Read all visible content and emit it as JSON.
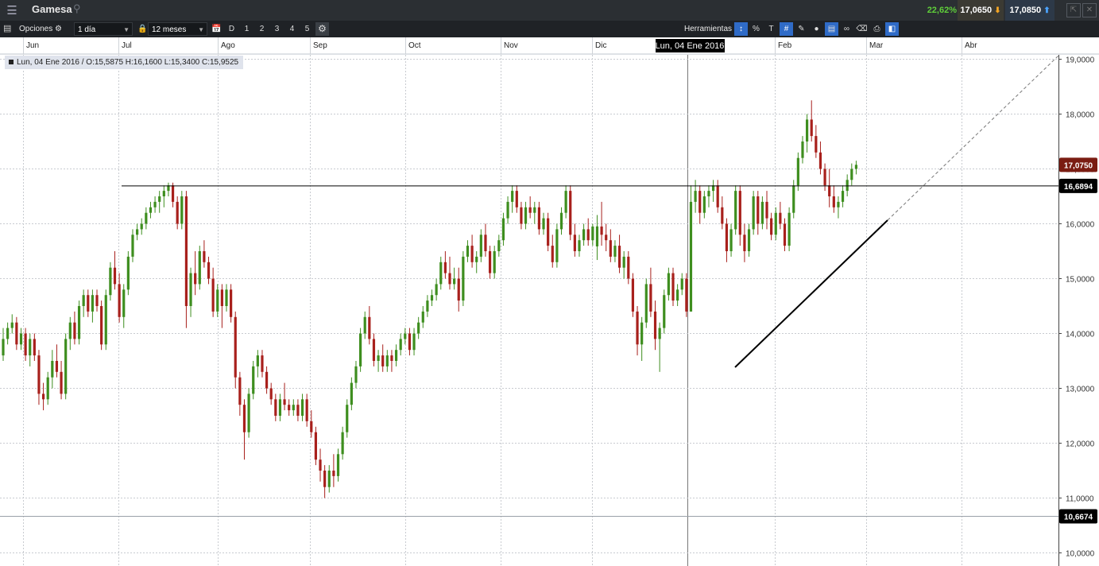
{
  "topbar": {
    "symbol": "Gamesa",
    "change_pct": "22,62%",
    "bid": "17,0650",
    "ask": "17,0850"
  },
  "toolbar": {
    "options_label": "Opciones",
    "interval": "1 día",
    "range": "12 meses",
    "periods": [
      "D",
      "1",
      "2",
      "3",
      "4",
      "5"
    ],
    "tools_label": "Herramientas"
  },
  "crosshair": {
    "date_label": "Lun, 04 Ene 2016",
    "info": "Lun, 04 Ene 2016 / O:15,5875  H:16,1600  L:15,3400  C:15,9525"
  },
  "colors": {
    "up": "#3e8e1f",
    "down": "#a8201c",
    "price_tag": "#7a1c12",
    "line_tag": "#000000"
  },
  "chart_data": {
    "type": "candlestick",
    "x_ticks": [
      "Jun",
      "Jul",
      "Ago",
      "Sep",
      "Oct",
      "Nov",
      "Dic",
      "Feb",
      "Mar",
      "Abr"
    ],
    "y_ticks": [
      "19,0000",
      "18,0000",
      "17,0000",
      "16,0000",
      "15,0000",
      "14,0000",
      "13,0000",
      "12,0000",
      "11,0000",
      "10,0000"
    ],
    "y_range": [
      10.0,
      19.0
    ],
    "last_price": "17,0750",
    "resistance_level": "16,6894",
    "lower_level": "10,6674",
    "candles": [
      [
        13.6,
        14.1,
        13.5,
        13.9
      ],
      [
        13.9,
        14.2,
        13.8,
        14.1
      ],
      [
        14.1,
        14.35,
        14.0,
        14.2
      ],
      [
        14.2,
        14.3,
        13.7,
        13.8
      ],
      [
        13.8,
        14.1,
        13.7,
        14.0
      ],
      [
        14.0,
        14.1,
        13.5,
        13.6
      ],
      [
        13.6,
        14.0,
        13.4,
        13.9
      ],
      [
        13.9,
        14.0,
        13.5,
        13.6
      ],
      [
        13.6,
        13.7,
        12.7,
        12.9
      ],
      [
        12.9,
        13.1,
        12.6,
        12.8
      ],
      [
        12.8,
        13.3,
        12.7,
        13.2
      ],
      [
        13.2,
        13.7,
        13.0,
        13.5
      ],
      [
        13.5,
        13.8,
        13.2,
        13.3
      ],
      [
        13.3,
        13.5,
        12.8,
        12.9
      ],
      [
        12.9,
        14.0,
        12.8,
        13.9
      ],
      [
        13.9,
        14.3,
        13.7,
        14.2
      ],
      [
        14.2,
        14.4,
        13.8,
        13.9
      ],
      [
        13.9,
        14.6,
        13.8,
        14.5
      ],
      [
        14.5,
        14.8,
        14.3,
        14.7
      ],
      [
        14.7,
        14.8,
        14.3,
        14.4
      ],
      [
        14.4,
        14.8,
        14.2,
        14.7
      ],
      [
        14.7,
        14.8,
        14.4,
        14.5
      ],
      [
        14.5,
        14.6,
        13.7,
        13.8
      ],
      [
        13.8,
        14.8,
        13.7,
        14.7
      ],
      [
        14.7,
        15.3,
        14.6,
        15.2
      ],
      [
        15.2,
        15.5,
        14.8,
        14.9
      ],
      [
        14.9,
        15.1,
        14.2,
        14.3
      ],
      [
        14.3,
        14.9,
        14.1,
        14.8
      ],
      [
        14.8,
        15.5,
        14.7,
        15.4
      ],
      [
        15.4,
        15.9,
        15.3,
        15.8
      ],
      [
        15.8,
        16.0,
        15.7,
        15.9
      ],
      [
        15.9,
        16.1,
        15.8,
        16.0
      ],
      [
        16.0,
        16.3,
        15.9,
        16.2
      ],
      [
        16.2,
        16.4,
        16.1,
        16.3
      ],
      [
        16.3,
        16.5,
        16.2,
        16.4
      ],
      [
        16.4,
        16.6,
        16.2,
        16.5
      ],
      [
        16.5,
        16.7,
        16.3,
        16.6
      ],
      [
        16.6,
        16.75,
        16.5,
        16.7
      ],
      [
        16.7,
        16.75,
        16.3,
        16.4
      ],
      [
        16.4,
        16.5,
        15.9,
        16.0
      ],
      [
        16.0,
        16.6,
        15.9,
        16.5
      ],
      [
        16.5,
        16.6,
        14.1,
        14.5
      ],
      [
        14.5,
        15.2,
        14.3,
        15.1
      ],
      [
        15.1,
        15.5,
        14.7,
        14.9
      ],
      [
        14.9,
        15.6,
        14.8,
        15.5
      ],
      [
        15.5,
        15.7,
        15.2,
        15.3
      ],
      [
        15.3,
        15.4,
        14.9,
        15.0
      ],
      [
        15.0,
        15.2,
        14.3,
        14.4
      ],
      [
        14.4,
        14.9,
        14.3,
        14.8
      ],
      [
        14.8,
        14.9,
        14.1,
        14.5
      ],
      [
        14.5,
        14.9,
        14.4,
        14.8
      ],
      [
        14.8,
        14.9,
        14.2,
        14.3
      ],
      [
        14.3,
        14.4,
        13.0,
        13.2
      ],
      [
        13.2,
        13.3,
        12.5,
        12.7
      ],
      [
        12.7,
        12.8,
        11.7,
        12.2
      ],
      [
        12.2,
        13.0,
        12.1,
        12.9
      ],
      [
        12.9,
        13.5,
        12.8,
        13.4
      ],
      [
        13.4,
        13.7,
        13.2,
        13.6
      ],
      [
        13.6,
        13.7,
        13.2,
        13.3
      ],
      [
        13.3,
        13.4,
        12.9,
        13.0
      ],
      [
        13.0,
        13.1,
        12.7,
        12.8
      ],
      [
        12.8,
        12.9,
        12.4,
        12.5
      ],
      [
        12.5,
        12.9,
        12.4,
        12.8
      ],
      [
        12.8,
        13.1,
        12.6,
        12.7
      ],
      [
        12.7,
        12.8,
        12.5,
        12.6
      ],
      [
        12.6,
        12.8,
        12.5,
        12.7
      ],
      [
        12.7,
        12.8,
        12.4,
        12.5
      ],
      [
        12.5,
        12.9,
        12.4,
        12.8
      ],
      [
        12.8,
        12.9,
        12.3,
        12.4
      ],
      [
        12.4,
        12.6,
        12.1,
        12.2
      ],
      [
        12.2,
        12.3,
        11.6,
        11.7
      ],
      [
        11.7,
        11.9,
        11.3,
        11.5
      ],
      [
        11.5,
        11.6,
        11.0,
        11.2
      ],
      [
        11.2,
        11.6,
        11.1,
        11.5
      ],
      [
        11.5,
        11.8,
        11.2,
        11.4
      ],
      [
        11.4,
        11.9,
        11.3,
        11.8
      ],
      [
        11.8,
        12.3,
        11.7,
        12.2
      ],
      [
        12.2,
        12.8,
        12.1,
        12.7
      ],
      [
        12.7,
        13.2,
        12.6,
        13.1
      ],
      [
        13.1,
        13.5,
        13.0,
        13.4
      ],
      [
        13.4,
        14.1,
        13.3,
        14.0
      ],
      [
        14.0,
        14.4,
        13.9,
        14.3
      ],
      [
        14.3,
        14.5,
        13.8,
        13.9
      ],
      [
        13.9,
        14.0,
        13.4,
        13.5
      ],
      [
        13.5,
        13.7,
        13.3,
        13.6
      ],
      [
        13.6,
        13.8,
        13.3,
        13.4
      ],
      [
        13.4,
        13.7,
        13.3,
        13.6
      ],
      [
        13.6,
        13.7,
        13.3,
        13.5
      ],
      [
        13.5,
        13.8,
        13.4,
        13.7
      ],
      [
        13.7,
        14.0,
        13.6,
        13.9
      ],
      [
        13.9,
        14.1,
        13.8,
        14.0
      ],
      [
        14.0,
        14.1,
        13.6,
        13.7
      ],
      [
        13.7,
        14.1,
        13.6,
        14.0
      ],
      [
        14.0,
        14.3,
        13.9,
        14.2
      ],
      [
        14.2,
        14.5,
        14.1,
        14.4
      ],
      [
        14.4,
        14.7,
        14.3,
        14.6
      ],
      [
        14.6,
        14.8,
        14.5,
        14.7
      ],
      [
        14.7,
        15.0,
        14.6,
        14.9
      ],
      [
        14.9,
        15.4,
        14.8,
        15.3
      ],
      [
        15.3,
        15.5,
        15.0,
        15.1
      ],
      [
        15.1,
        15.4,
        14.8,
        14.9
      ],
      [
        14.9,
        15.2,
        14.8,
        15.0
      ],
      [
        15.0,
        15.2,
        14.4,
        14.6
      ],
      [
        14.6,
        15.5,
        14.5,
        15.4
      ],
      [
        15.4,
        15.7,
        15.3,
        15.6
      ],
      [
        15.6,
        15.8,
        15.2,
        15.3
      ],
      [
        15.3,
        15.5,
        15.1,
        15.4
      ],
      [
        15.4,
        15.9,
        15.3,
        15.8
      ],
      [
        15.8,
        16.0,
        15.4,
        15.5
      ],
      [
        15.5,
        15.6,
        15.0,
        15.1
      ],
      [
        15.1,
        15.6,
        15.0,
        15.5
      ],
      [
        15.5,
        15.8,
        15.4,
        15.7
      ],
      [
        15.7,
        16.2,
        15.6,
        16.1
      ],
      [
        16.1,
        16.5,
        16.0,
        16.4
      ],
      [
        16.4,
        16.7,
        16.2,
        16.6
      ],
      [
        16.6,
        16.7,
        16.2,
        16.3
      ],
      [
        16.3,
        16.4,
        15.9,
        16.0
      ],
      [
        16.0,
        16.4,
        15.9,
        16.3
      ],
      [
        16.3,
        16.5,
        16.1,
        16.2
      ],
      [
        16.2,
        16.4,
        16.0,
        16.3
      ],
      [
        16.3,
        16.4,
        15.8,
        15.9
      ],
      [
        15.9,
        16.2,
        15.8,
        16.1
      ],
      [
        16.1,
        16.2,
        15.5,
        15.6
      ],
      [
        15.6,
        15.8,
        15.2,
        15.3
      ],
      [
        15.3,
        16.0,
        15.2,
        15.9
      ],
      [
        15.9,
        16.3,
        15.8,
        16.2
      ],
      [
        16.2,
        16.7,
        16.1,
        16.6
      ],
      [
        16.6,
        16.7,
        15.7,
        15.8
      ],
      [
        15.8,
        16.0,
        15.4,
        15.5
      ],
      [
        15.5,
        15.8,
        15.4,
        15.7
      ],
      [
        15.7,
        16.0,
        15.6,
        15.9
      ],
      [
        15.9,
        16.1,
        15.6,
        15.7
      ],
      [
        15.7,
        16.0,
        15.6,
        15.95
      ],
      [
        15.5875,
        16.16,
        15.34,
        15.9525
      ],
      [
        15.95,
        16.4,
        15.6,
        15.8
      ],
      [
        15.8,
        16.0,
        15.5,
        15.7
      ],
      [
        15.7,
        15.9,
        15.3,
        15.4
      ],
      [
        15.4,
        15.7,
        15.3,
        15.6
      ],
      [
        15.6,
        15.8,
        15.1,
        15.2
      ],
      [
        15.2,
        15.5,
        15.0,
        15.4
      ],
      [
        15.4,
        15.5,
        14.9,
        15.0
      ],
      [
        15.0,
        15.1,
        14.3,
        14.4
      ],
      [
        14.4,
        14.5,
        13.6,
        13.8
      ],
      [
        13.8,
        14.3,
        13.5,
        14.2
      ],
      [
        14.2,
        15.0,
        14.1,
        14.9
      ],
      [
        14.9,
        15.2,
        14.3,
        14.4
      ],
      [
        14.4,
        14.6,
        13.7,
        13.9
      ],
      [
        13.9,
        14.2,
        13.3,
        14.1
      ],
      [
        14.1,
        14.8,
        14.0,
        14.7
      ],
      [
        14.7,
        15.2,
        14.6,
        15.1
      ],
      [
        15.1,
        15.2,
        14.5,
        14.6
      ],
      [
        14.6,
        14.9,
        14.5,
        14.8
      ],
      [
        14.8,
        15.1,
        14.7,
        15.0
      ],
      [
        15.0,
        15.1,
        14.3,
        14.4
      ],
      [
        14.4,
        16.7,
        14.4,
        16.4
      ],
      [
        16.4,
        16.8,
        16.2,
        16.6
      ],
      [
        16.6,
        16.7,
        16.0,
        16.2
      ],
      [
        16.2,
        16.6,
        16.1,
        16.5
      ],
      [
        16.5,
        16.7,
        16.3,
        16.6
      ],
      [
        16.6,
        16.8,
        16.4,
        16.7
      ],
      [
        16.7,
        16.8,
        16.2,
        16.3
      ],
      [
        16.3,
        16.5,
        15.9,
        16.0
      ],
      [
        16.0,
        16.1,
        15.3,
        15.5
      ],
      [
        15.5,
        16.0,
        15.4,
        15.9
      ],
      [
        15.9,
        16.7,
        15.8,
        16.6
      ],
      [
        16.6,
        16.7,
        15.6,
        15.8
      ],
      [
        15.8,
        16.0,
        15.3,
        15.5
      ],
      [
        15.5,
        16.0,
        15.4,
        15.9
      ],
      [
        15.9,
        16.6,
        15.8,
        16.5
      ],
      [
        16.5,
        16.6,
        15.8,
        16.0
      ],
      [
        16.0,
        16.5,
        15.9,
        16.4
      ],
      [
        16.4,
        16.6,
        15.9,
        16.1
      ],
      [
        16.1,
        16.2,
        15.7,
        15.8
      ],
      [
        15.8,
        16.3,
        15.7,
        16.2
      ],
      [
        16.2,
        16.4,
        15.9,
        16.0
      ],
      [
        16.0,
        16.1,
        15.5,
        15.6
      ],
      [
        15.6,
        16.3,
        15.5,
        16.2
      ],
      [
        16.2,
        16.8,
        16.1,
        16.7
      ],
      [
        16.7,
        17.3,
        16.6,
        17.2
      ],
      [
        17.2,
        17.6,
        17.1,
        17.5
      ],
      [
        17.5,
        18.0,
        17.3,
        17.9
      ],
      [
        17.9,
        18.25,
        17.5,
        17.6
      ],
      [
        17.6,
        17.8,
        17.2,
        17.3
      ],
      [
        17.3,
        17.5,
        16.9,
        17.0
      ],
      [
        17.0,
        17.1,
        16.6,
        16.7
      ],
      [
        16.7,
        17.0,
        16.3,
        16.5
      ],
      [
        16.5,
        16.7,
        16.2,
        16.3
      ],
      [
        16.3,
        16.5,
        16.1,
        16.4
      ],
      [
        16.4,
        16.7,
        16.3,
        16.6
      ],
      [
        16.6,
        16.9,
        16.5,
        16.8
      ],
      [
        16.8,
        17.1,
        16.7,
        17.0
      ],
      [
        17.0,
        17.15,
        16.9,
        17.075
      ]
    ]
  }
}
